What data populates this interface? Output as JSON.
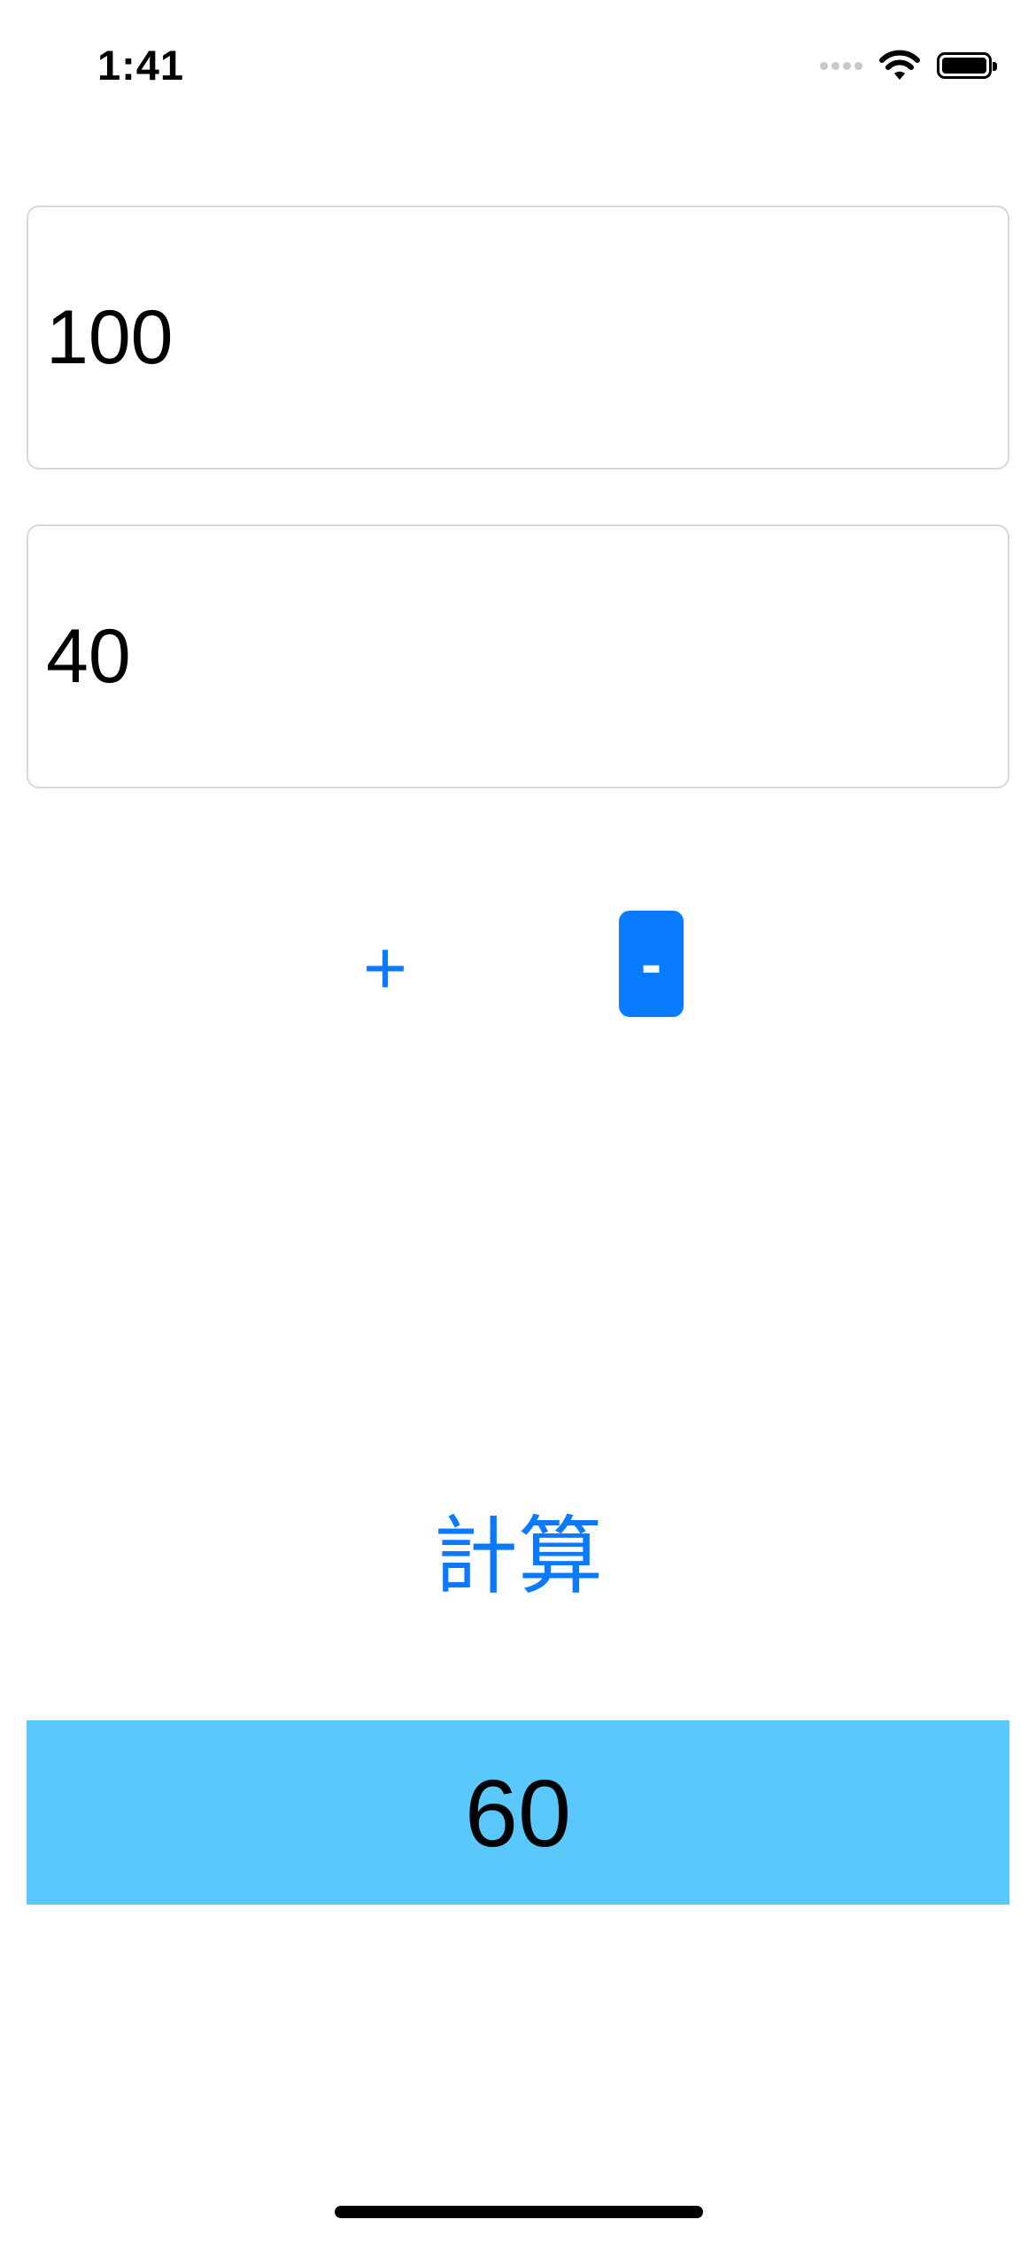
{
  "status_bar": {
    "time": "1:41",
    "icons": [
      "signal-icon",
      "wifi-icon",
      "battery-icon"
    ]
  },
  "inputs": {
    "first_value": "100",
    "second_value": "40"
  },
  "operators": {
    "plus_label": "+",
    "minus_label": "-",
    "selected": "minus"
  },
  "calculate_button": {
    "label": "計算"
  },
  "result": {
    "value": "60"
  },
  "colors": {
    "accent": "#0a7aff",
    "result_background": "#5ac8fa",
    "field_border": "#d7d7dc"
  }
}
